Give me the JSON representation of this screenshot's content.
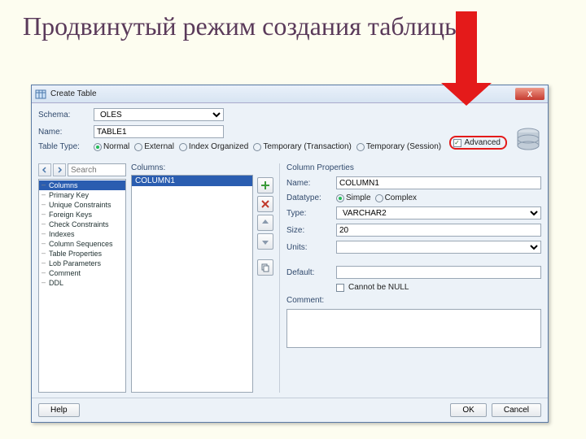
{
  "slide": {
    "title": "Продвинутый режим создания таблицы"
  },
  "dialog": {
    "title": "Create Table",
    "close_x": "X",
    "advanced_label": "Advanced",
    "advanced_checked": true,
    "schema_label": "Schema:",
    "schema_value": "OLES",
    "name_label": "Name:",
    "name_value": "TABLE1",
    "tabletype_label": "Table Type:",
    "tabletype_options": [
      "Normal",
      "External",
      "Index Organized",
      "Temporary (Transaction)",
      "Temporary (Session)"
    ],
    "tabletype_selected": "Normal",
    "search_placeholder": "Search",
    "tree_items": [
      "Columns",
      "Primary Key",
      "Unique Constraints",
      "Foreign Keys",
      "Check Constraints",
      "Indexes",
      "Column Sequences",
      "Table Properties",
      "Lob Parameters",
      "Comment",
      "DDL"
    ],
    "tree_selected": "Columns",
    "columns_header": "Columns:",
    "columns_list": [
      "COLUMN1"
    ],
    "columns_selected": "COLUMN1",
    "props": {
      "header": "Column Properties",
      "name_label": "Name:",
      "name_value": "COLUMN1",
      "datatype_label": "Datatype:",
      "datatype_options": [
        "Simple",
        "Complex"
      ],
      "datatype_selected": "Simple",
      "type_label": "Type:",
      "type_value": "VARCHAR2",
      "size_label": "Size:",
      "size_value": "20",
      "units_label": "Units:",
      "units_value": "",
      "default_label": "Default:",
      "default_value": "",
      "notnull_label": "Cannot be NULL",
      "notnull_checked": false,
      "comment_label": "Comment:",
      "comment_value": ""
    },
    "footer": {
      "help": "Help",
      "ok": "OK",
      "cancel": "Cancel"
    }
  }
}
